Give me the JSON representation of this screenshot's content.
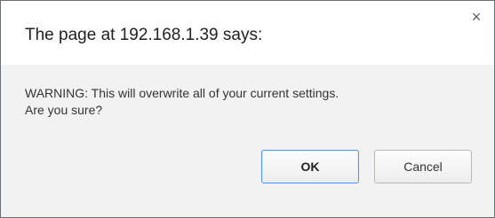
{
  "dialog": {
    "title": "The page at 192.168.1.39 says:",
    "message_line1": "WARNING: This will overwrite all of your current settings.",
    "message_line2": "Are you sure?",
    "close_glyph": "×",
    "ok_label": "OK",
    "cancel_label": "Cancel"
  },
  "colors": {
    "focus_border": "#4d90fe",
    "body_bg": "#f2f2f2"
  }
}
